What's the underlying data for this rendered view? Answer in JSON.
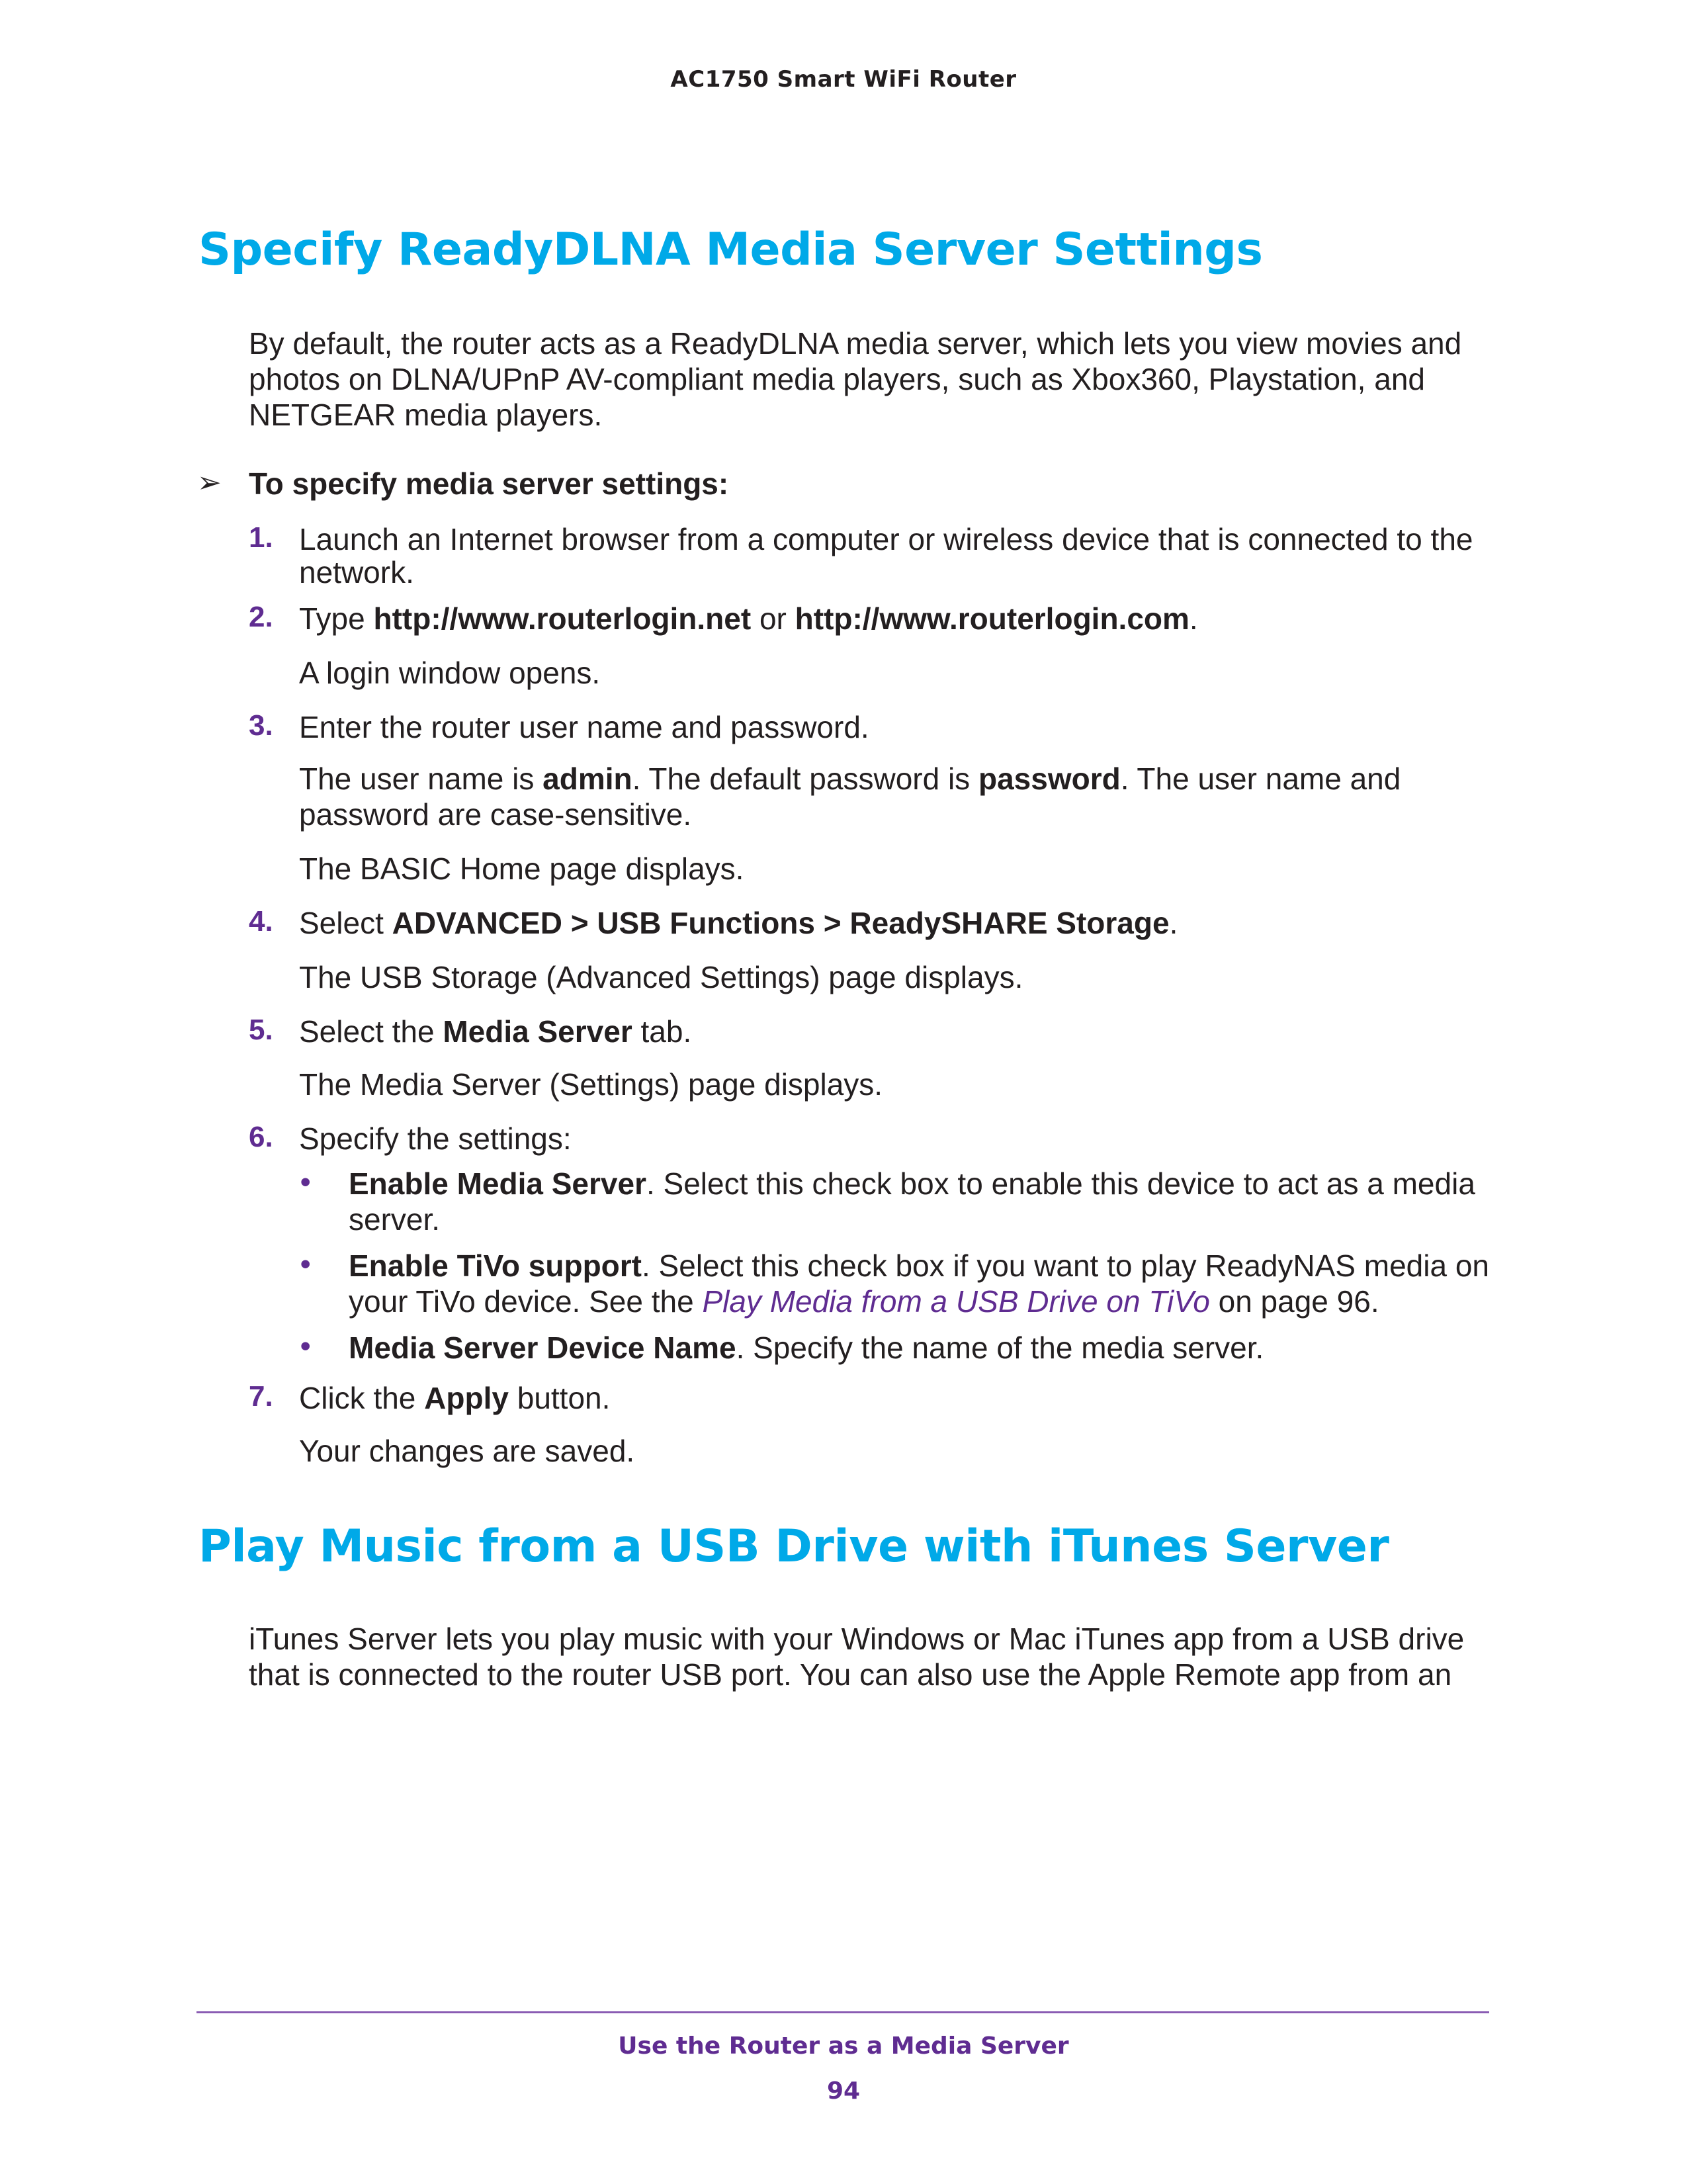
{
  "header": {
    "running_title": "AC1750 Smart WiFi Router"
  },
  "section1": {
    "heading": "Specify ReadyDLNA Media Server Settings",
    "intro_lines": [
      "By default, the router acts as a ReadyDLNA media server, which lets you view movies and",
      "photos on DLNA/UPnP AV-compliant media players, such as Xbox360, Playstation, and",
      "NETGEAR media players."
    ],
    "procedure_title": "To specify media server settings:",
    "steps": [
      {
        "number": "1.",
        "lines": [
          "Launch an Internet browser from a computer or wireless device that is connected to the",
          "network."
        ]
      },
      {
        "number": "2.",
        "prefix": "Type ",
        "url1": "http://www.routerlogin.net",
        "mid": " or ",
        "url2": "http://www.routerlogin.com",
        "suffix": ".",
        "result": "A login window opens."
      },
      {
        "number": "3.",
        "text": "Enter the router user name and password.",
        "detail_a": "The user name is ",
        "username": "admin",
        "detail_b": ". The default password is ",
        "password": "password",
        "detail_c": ". The user name and",
        "detail_line2": "password are case-sensitive.",
        "result": "The BASIC Home page displays."
      },
      {
        "number": "4.",
        "prefix": "Select ",
        "path": "ADVANCED > USB Functions > ReadySHARE Storage",
        "suffix": ".",
        "result": "The USB Storage (Advanced Settings) page displays."
      },
      {
        "number": "5.",
        "prefix": "Select the ",
        "tab": "Media Server",
        "suffix": " tab.",
        "result": "The Media Server (Settings) page displays."
      },
      {
        "number": "6.",
        "text": "Specify the settings:",
        "bullets": [
          {
            "term": "Enable Media Server",
            "desc_line1": ". Select this check box to enable this device to act as a media",
            "desc_line2": "server."
          },
          {
            "term": "Enable TiVo support",
            "desc_line1": ". Select this check box if you want to play ReadyNAS media on",
            "desc_line2_a": "your TiVo device. See the ",
            "xref": "Play Media from a USB Drive on TiVo",
            "desc_line2_b": " on page 96."
          },
          {
            "term": "Media Server Device Name",
            "desc_line1": ". Specify the name of the media server."
          }
        ]
      },
      {
        "number": "7.",
        "prefix": "Click the ",
        "button": "Apply",
        "suffix": " button.",
        "result": "Your changes are saved."
      }
    ]
  },
  "section2": {
    "heading": "Play Music from a USB Drive with iTunes Server",
    "intro_lines": [
      "iTunes Server lets you play music with your Windows or Mac iTunes app from a USB drive",
      "that is connected to the router USB port. You can also use the Apple Remote app from an"
    ]
  },
  "footer": {
    "chapter_title": "Use the Router as a Media Server",
    "page_number": "94"
  },
  "icons": {
    "procedure_marker": "arrowhead-icon",
    "bullet": "bullet-dot-icon"
  },
  "colors": {
    "heading": "#00a9e8",
    "accent": "#5f2c91",
    "text": "#231f20"
  }
}
